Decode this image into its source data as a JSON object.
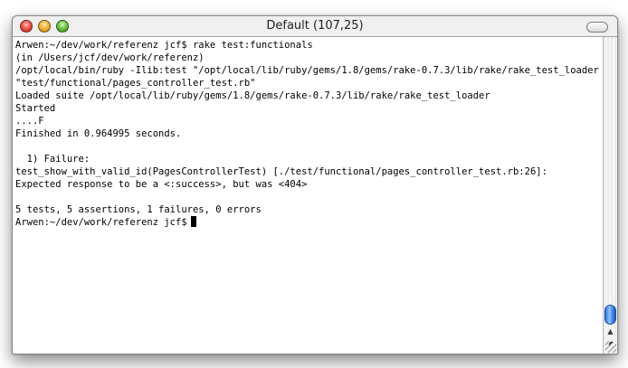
{
  "window": {
    "title": "Default (107,25)"
  },
  "terminal": {
    "lines": [
      "Arwen:~/dev/work/referenz jcf$ rake test:functionals",
      "(in /Users/jcf/dev/work/referenz)",
      "/opt/local/bin/ruby -Ilib:test \"/opt/local/lib/ruby/gems/1.8/gems/rake-0.7.3/lib/rake/rake_test_loader.rb\"",
      "\"test/functional/pages_controller_test.rb\"",
      "Loaded suite /opt/local/lib/ruby/gems/1.8/gems/rake-0.7.3/lib/rake/rake_test_loader",
      "Started",
      "....F",
      "Finished in 0.964995 seconds.",
      "",
      "  1) Failure:",
      "test_show_with_valid_id(PagesControllerTest) [./test/functional/pages_controller_test.rb:26]:",
      "Expected response to be a <:success>, but was <404>",
      "",
      "5 tests, 5 assertions, 1 failures, 0 errors"
    ],
    "prompt": "Arwen:~/dev/work/referenz jcf$"
  },
  "scrollbar": {
    "up_arrow": "▲",
    "down_arrow": "▼"
  },
  "icons": {
    "close": "close-icon",
    "minimize": "minimize-icon",
    "zoom": "zoom-icon",
    "toolbar_toggle": "toolbar-toggle-icon"
  },
  "colors": {
    "close": "#f0584a",
    "minimize": "#f3b73a",
    "zoom": "#72c44a",
    "scroll_thumb": "#4a8ae6",
    "text": "#000000",
    "background": "#ffffff"
  }
}
